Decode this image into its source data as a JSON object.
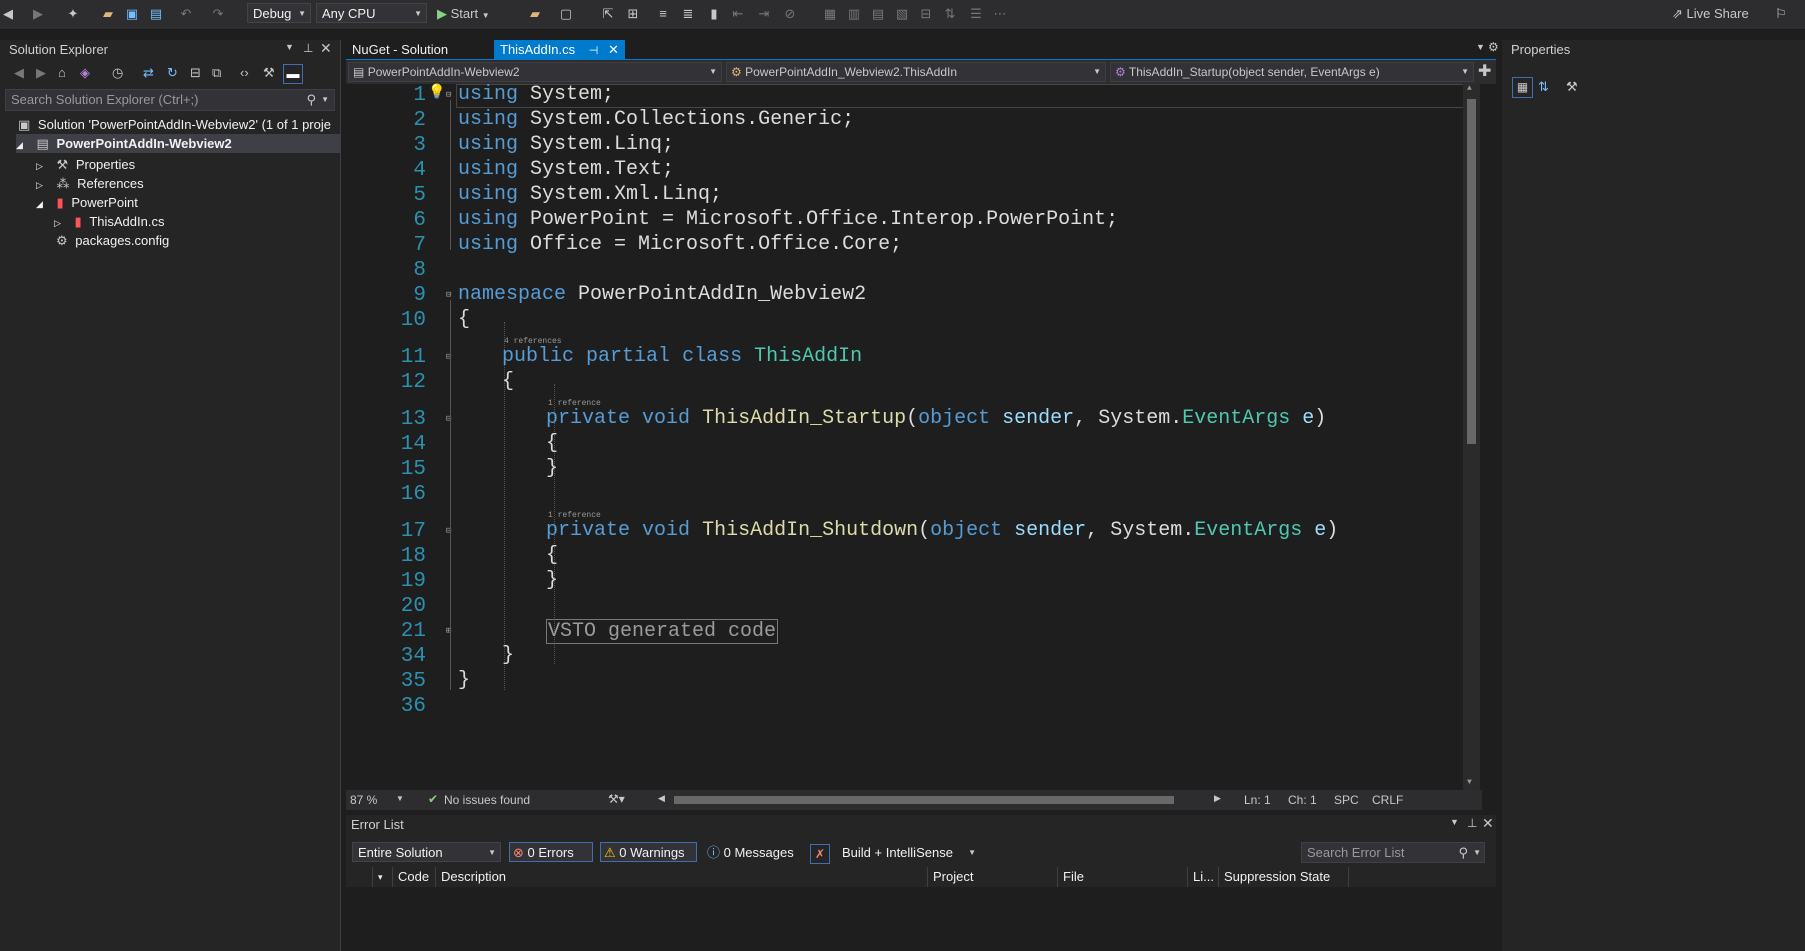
{
  "toolbar": {
    "configuration": "Debug",
    "platform": "Any CPU",
    "start_label": "Start",
    "live_share": "Live Share"
  },
  "solution_explorer": {
    "title": "Solution Explorer",
    "search_placeholder": "Search Solution Explorer (Ctrl+;)",
    "items": [
      {
        "label": "Solution 'PowerPointAddIn-Webview2' (1 of 1 proje",
        "icon": "solution-icon"
      },
      {
        "label": "PowerPointAddIn-Webview2",
        "icon": "csharp-project-icon"
      },
      {
        "label": "Properties",
        "icon": "wrench-icon"
      },
      {
        "label": "References",
        "icon": "references-icon"
      },
      {
        "label": "PowerPoint",
        "icon": "powerpoint-icon"
      },
      {
        "label": "ThisAddIn.cs",
        "icon": "powerpoint-icon"
      },
      {
        "label": "packages.config",
        "icon": "config-file-icon"
      }
    ]
  },
  "editor": {
    "tabs": [
      {
        "label": "NuGet - Solution",
        "active": false
      },
      {
        "label": "ThisAddIn.cs",
        "active": true
      }
    ],
    "nav": {
      "project": "PowerPointAddIn-Webview2",
      "type": "PowerPointAddIn_Webview2.ThisAddIn",
      "member": "ThisAddIn_Startup(object sender, EventArgs e)"
    },
    "line_numbers": [
      "1",
      "2",
      "3",
      "4",
      "5",
      "6",
      "7",
      "8",
      "9",
      "10",
      "11",
      "12",
      "13",
      "14",
      "15",
      "16",
      "17",
      "18",
      "19",
      "20",
      "21",
      "34",
      "35",
      "36"
    ],
    "lens": {
      "class_refs": "4 references",
      "startup_refs": "1 reference",
      "shutdown_refs": "1 reference"
    },
    "code": {
      "l1": "System;",
      "l2": "System.Collections.Generic;",
      "l3": "System.Linq;",
      "l4": "System.Text;",
      "l5": "System.Xml.Linq;",
      "l6": "PowerPoint = Microsoft.Office.Interop.PowerPoint;",
      "l7": "Office = Microsoft.Office.Core;",
      "ns_name": "PowerPointAddIn_Webview2",
      "class_name": "ThisAddIn",
      "startup_name": "ThisAddIn_Startup",
      "shutdown_name": "ThisAddIn_Shutdown",
      "region": "VSTO generated code",
      "kw_using": "using",
      "kw_namespace": "namespace",
      "kw_public": "public",
      "kw_partial": "partial",
      "kw_class": "class",
      "kw_private": "private",
      "kw_void": "void",
      "kw_object": "object",
      "param_sender": "sender",
      "param_e": "e",
      "system": "System.",
      "eventargs": "EventArgs"
    },
    "status": {
      "zoom": "87 %",
      "issues": "No issues found",
      "line": "Ln: 1",
      "column": "Ch: 1",
      "whitespace": "SPC",
      "line_ending": "CRLF"
    }
  },
  "error_list": {
    "title": "Error List",
    "scope": "Entire Solution",
    "errors": "0 Errors",
    "warnings": "0 Warnings",
    "messages": "0 Messages",
    "source": "Build + IntelliSense",
    "search_placeholder": "Search Error List",
    "columns": [
      "Code",
      "Description",
      "Project",
      "File",
      "Li...",
      "Suppression State"
    ]
  },
  "properties": {
    "title": "Properties"
  }
}
